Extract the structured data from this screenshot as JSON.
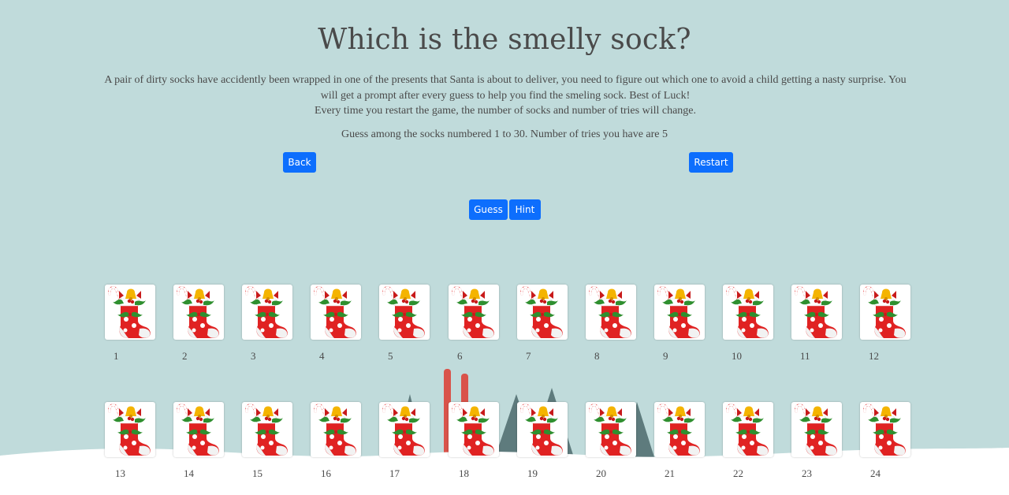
{
  "page": {
    "title": "Which is the smelly sock?",
    "intro_line_1": "A pair of dirty socks have accidently been wrapped in one of the presents that Santa is about to deliver, you need to figure out which one to avoid a child getting a nasty surprise. You will get a prompt after every guess to help you find the smeling sock. Best of Luck!",
    "intro_line_2": "Every time you restart the game, the number of socks and number of tries will change.",
    "guess_info": "Guess among the socks numbered 1 to 30. Number of tries you have are 5"
  },
  "buttons": {
    "back": "Back",
    "restart": "Restart",
    "guess": "Guess",
    "hint": "Hint"
  },
  "socks": {
    "row1": [
      "1",
      "2",
      "3",
      "4",
      "5",
      "6",
      "7",
      "8",
      "9",
      "10",
      "11",
      "12"
    ],
    "row2": [
      "13",
      "14",
      "15",
      "16",
      "17",
      "18",
      "19",
      "20",
      "21",
      "22",
      "23",
      "24"
    ]
  },
  "colors": {
    "background": "#c0dbdb",
    "button": "#0d6efd",
    "sock_red": "#e02222",
    "snow": "#ffffff",
    "tree": "#5e7b7d"
  }
}
